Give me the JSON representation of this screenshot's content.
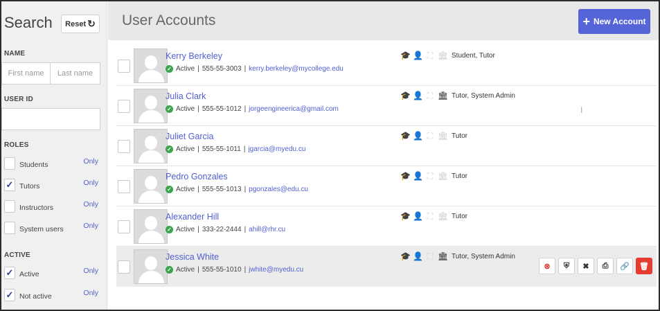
{
  "sidebar": {
    "title": "Search",
    "reset_label": "Reset",
    "name_label": "NAME",
    "first_name_placeholder": "First name",
    "last_name_placeholder": "Last name",
    "userid_label": "USER ID",
    "userid_value": "",
    "roles_label": "ROLES",
    "roles": [
      {
        "label": "Students",
        "checked": false,
        "only": "Only"
      },
      {
        "label": "Tutors",
        "checked": true,
        "only": "Only"
      },
      {
        "label": "Instructors",
        "checked": false,
        "only": "Only"
      },
      {
        "label": "System users",
        "checked": false,
        "only": "Only"
      }
    ],
    "active_label": "ACTIVE",
    "active": [
      {
        "label": "Active",
        "checked": true,
        "only": "Only"
      },
      {
        "label": "Not active",
        "checked": true,
        "only": "Only"
      }
    ]
  },
  "header": {
    "title": "User Accounts",
    "new_account_label": "New Account"
  },
  "users": [
    {
      "name": "Kerry Berkeley",
      "status": "Active",
      "phone": "555-55-3003",
      "email": "kerry.berkeley@mycollege.edu",
      "roles_text": "Student, Tutor",
      "role_icons": [
        true,
        true,
        false,
        false
      ]
    },
    {
      "name": "Julia Clark",
      "status": "Active",
      "phone": "555-55-1012",
      "email": "jorgeengineerica@gmail.com",
      "roles_text": "Tutor, System Admin",
      "role_icons": [
        false,
        true,
        false,
        true
      ]
    },
    {
      "name": "Juliet Garcia",
      "status": "Active",
      "phone": "555-55-1011",
      "email": "jgarcia@myedu.cu",
      "roles_text": "Tutor",
      "role_icons": [
        false,
        true,
        false,
        false
      ]
    },
    {
      "name": "Pedro Gonzales",
      "status": "Active",
      "phone": "555-55-1013",
      "email": "pgonzales@edu.cu",
      "roles_text": "Tutor",
      "role_icons": [
        false,
        true,
        false,
        false
      ]
    },
    {
      "name": "Alexander Hill",
      "status": "Active",
      "phone": "333-22-2444",
      "email": "ahill@rhr.cu",
      "roles_text": "Tutor",
      "role_icons": [
        false,
        true,
        false,
        false
      ]
    },
    {
      "name": "Jessica White",
      "status": "Active",
      "phone": "555-55-1010",
      "email": "jwhite@myedu.cu",
      "roles_text": "Tutor, System Admin",
      "role_icons": [
        false,
        true,
        false,
        true
      ]
    }
  ],
  "row_actions": [
    "deactivate-icon",
    "shield-icon",
    "tools-icon",
    "print-icon",
    "link-icon",
    "trash-icon"
  ],
  "colors": {
    "accent": "#5565d8",
    "link": "#5060d0",
    "success": "#3ba34a",
    "danger": "#e33c30"
  }
}
